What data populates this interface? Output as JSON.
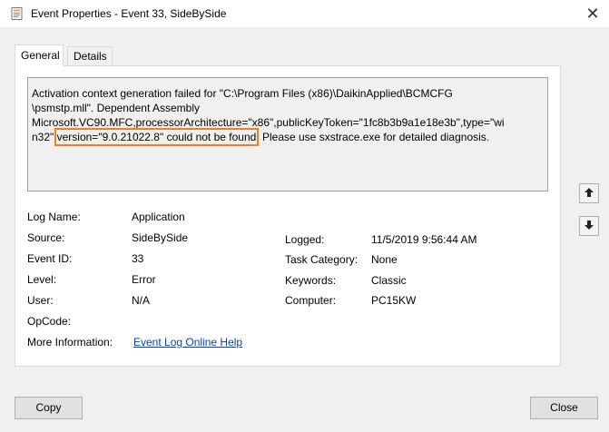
{
  "window": {
    "title": "Event Properties - Event 33, SideBySide",
    "close_glyph": "✕"
  },
  "tabs": [
    {
      "label": "General",
      "active": true
    },
    {
      "label": "Details",
      "active": false
    }
  ],
  "description": {
    "line1": "Activation context generation failed for \"C:\\Program Files (x86)\\DaikinApplied\\BCMCFG",
    "line2": "\\psmstp.mll\". Dependent Assembly",
    "line3": "Microsoft.VC90.MFC,processorArchitecture=\"x86\",publicKeyToken=\"1fc8b3b9a1e18e3b\",type=\"wi",
    "line4_pre": "n32\" ",
    "line4_highlight": "version=\"9.0.21022.8\" could not be found",
    "line4_post": ". Please use sxstrace.exe for detailed diagnosis.",
    "highlight_color": "#f07e26"
  },
  "fields": {
    "log_name_label": "Log Name:",
    "log_name_value": "Application",
    "source_label": "Source:",
    "source_value": "SideBySide",
    "logged_label": "Logged:",
    "logged_value": "11/5/2019 9:56:44 AM",
    "event_id_label": "Event ID:",
    "event_id_value": "33",
    "task_category_label": "Task Category:",
    "task_category_value": "None",
    "level_label": "Level:",
    "level_value": "Error",
    "keywords_label": "Keywords:",
    "keywords_value": "Classic",
    "user_label": "User:",
    "user_value": "N/A",
    "computer_label": "Computer:",
    "computer_value": "PC15KW",
    "opcode_label": "OpCode:",
    "opcode_value": "",
    "more_info_label": "More Information:",
    "more_info_link": "Event Log Online Help"
  },
  "buttons": {
    "copy": "Copy",
    "close": "Close"
  },
  "icons": {
    "app": "event-viewer-icon",
    "up": "arrow-up-icon",
    "down": "arrow-down-icon"
  }
}
